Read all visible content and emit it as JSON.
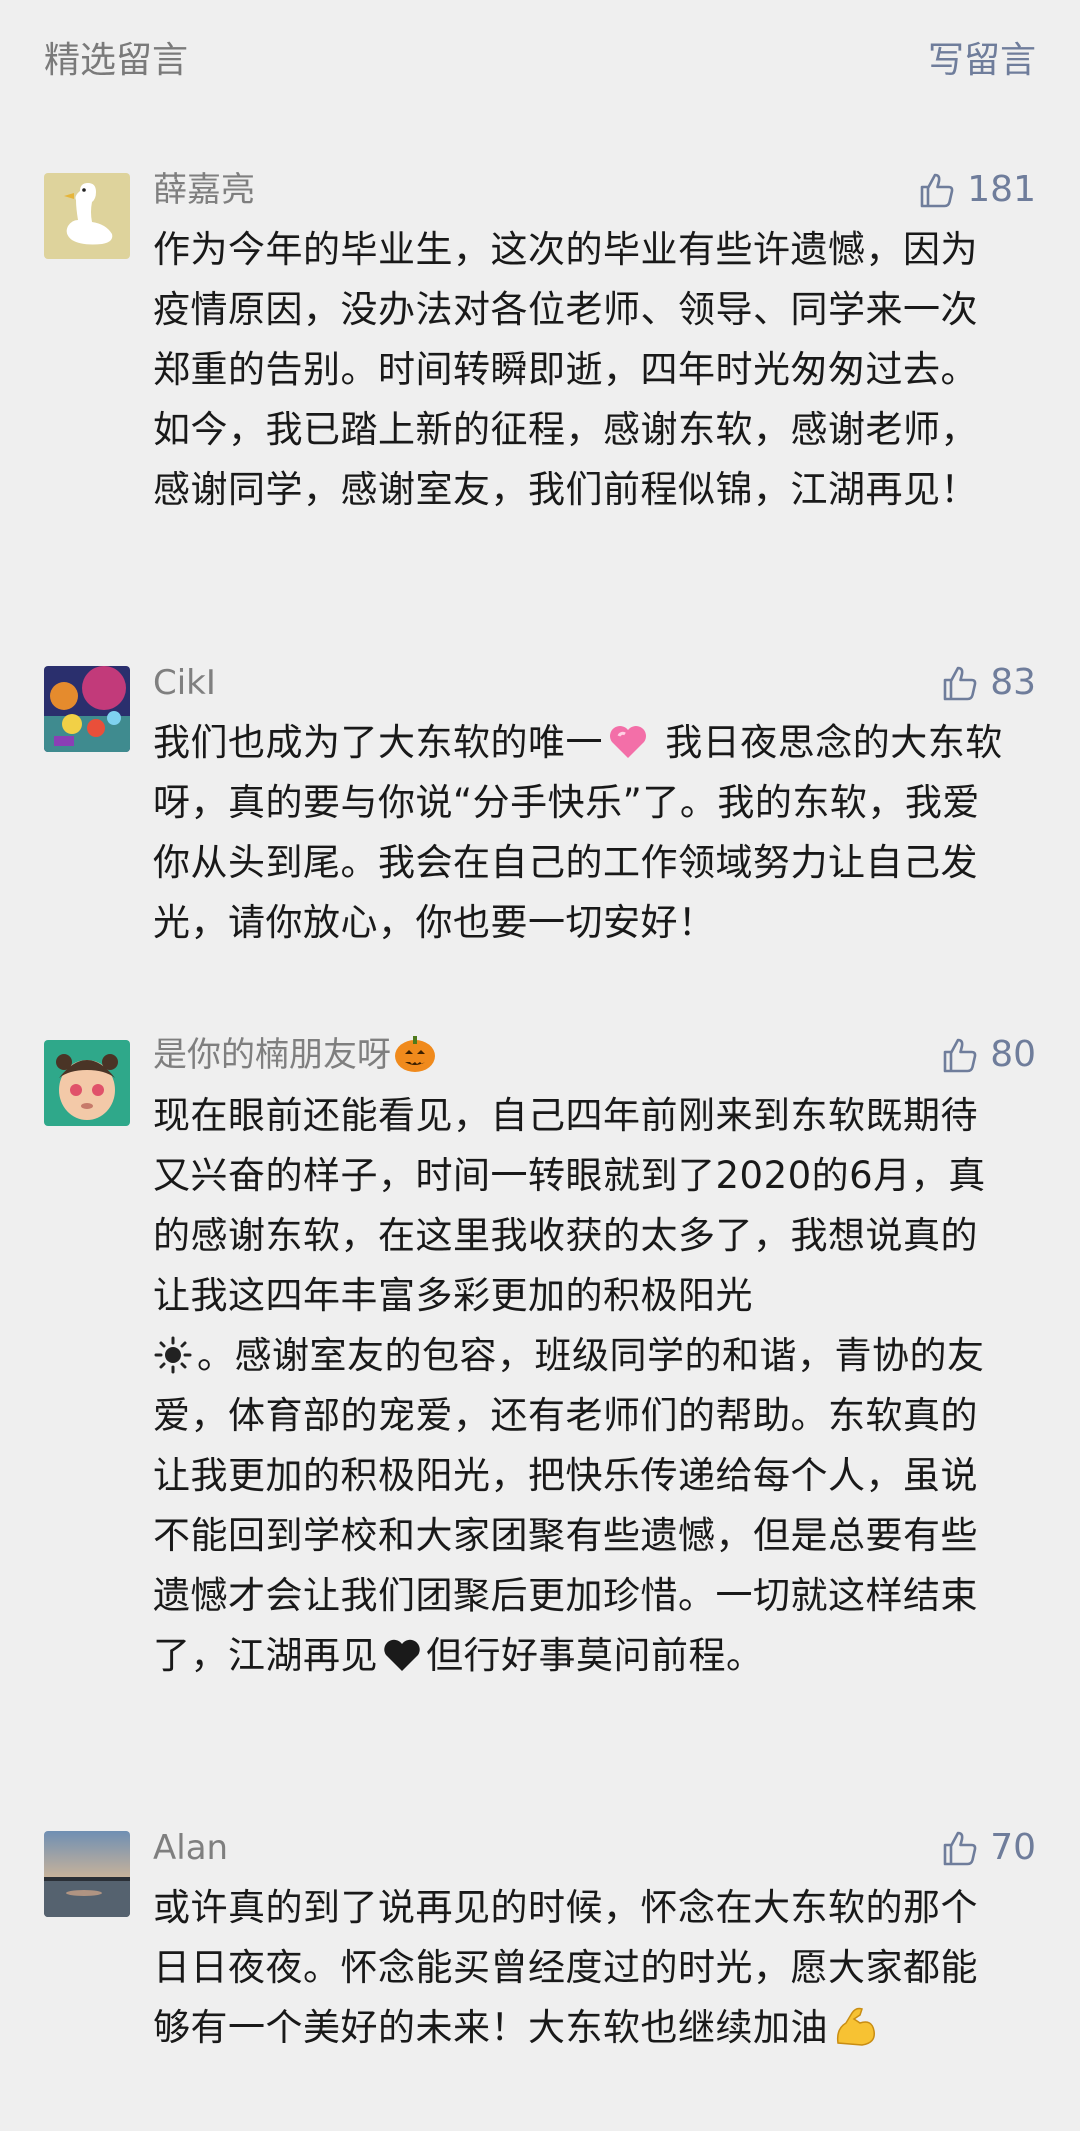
{
  "header": {
    "title": "精选留言",
    "write_label": "写留言"
  },
  "comments": [
    {
      "nickname": "薛嘉亮",
      "likes": "181",
      "avatar_icon": "goose-avatar",
      "text": "作为今年的毕业生，这次的毕业有些许遗憾，因为疫情原因，没办法对各位老师、领导、同学来一次郑重的告别。时间转瞬即逝，四年时光匆匆过去。如今，我已踏上新的征程，感谢东软，感谢老师，感谢同学，感谢室友，我们前程似锦，江湖再见！"
    },
    {
      "nickname": "CikI",
      "likes": "83",
      "avatar_icon": "colorful-scene-avatar",
      "text_a": "我们也成为了大东软的唯一",
      "emoji_a": "sparkling-heart-emoji",
      "text_b": " 我日夜思念的大东软呀，真的要与你说“分手快乐”了。我的东软，我爱你从头到尾。我会在自己的工作领域努力让自己发光，请你放心，你也要一切安好！"
    },
    {
      "nickname": "是你的楠朋友呀",
      "nickname_emoji": "pumpkin-emoji",
      "likes": "80",
      "avatar_icon": "child-photo-avatar",
      "text_a": "现在眼前还能看见，自己四年前刚来到东软既期待又兴奋的样子，时间一转眼就到了2020的6月，真的感谢东软，在这里我收获的太多了，我想说真的让我这四年丰富多彩更加的积极阳光",
      "emoji_a": "sun-emoji",
      "text_b": "。感谢室友的包容，班级同学的和谐，青协的友爱，体育部的宠爱，还有老师们的帮助。东软真的让我更加的积极阳光，把快乐传递给每个人，虽说不能回到学校和大家团聚有些遗憾，但是总要有些遗憾才会让我们团聚后更加珍惜。一切就这样结束了，江湖再见",
      "emoji_b": "black-heart-emoji",
      "text_c": "但行好事莫问前程。"
    },
    {
      "nickname": "Alan",
      "likes": "70",
      "avatar_icon": "sunset-lake-avatar",
      "text_a": "或许真的到了说再见的时候，怀念在大东软的那个日日夜夜。怀念能买曾经度过的时光，愿大家都能够有一个美好的未来！大东软也继续加油",
      "emoji_a": "flexed-biceps-emoji"
    }
  ],
  "colors": {
    "background": "#efefef",
    "link_blue": "#6f7d9b",
    "nickname_gray": "#7f7f7f",
    "text": "#191919"
  }
}
